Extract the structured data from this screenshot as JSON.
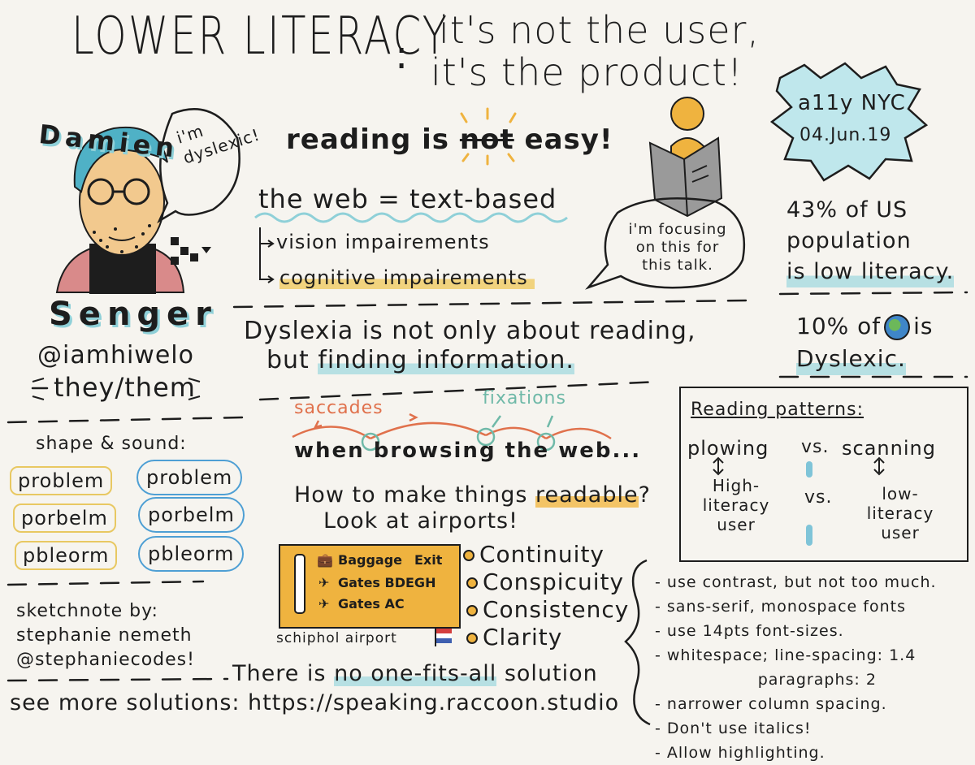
{
  "title": {
    "main": "LOWER LITERACY",
    "colon": ":",
    "line1": "it's not the user,",
    "line2": "it's the product!"
  },
  "speaker": {
    "first": "Damien",
    "last": "Senger",
    "handle": "@iamhiwelo",
    "pronouns": "they/them",
    "bubble": [
      "i'm",
      "dyslexic!"
    ]
  },
  "event": {
    "name": "a11y NYC",
    "date": "04.Jun.19"
  },
  "reading": {
    "pre": "reading is ",
    "not": "not",
    "post": " easy!"
  },
  "web": {
    "line": "the web = text-based",
    "items": [
      "vision impairements",
      "cognitive impairements"
    ],
    "bubble": "i'm focusing on this for this talk."
  },
  "stats": {
    "literacy": [
      "43% of US",
      "population",
      "is low literacy."
    ],
    "dyslexic_pre": "10% of",
    "dyslexic_post": "is",
    "dyslexic_line2": "Dyslexic."
  },
  "dyslexia": {
    "line1": "Dyslexia is not only about reading,",
    "line2_pre": "but ",
    "line2_hl": "finding information."
  },
  "eye": {
    "saccades": "saccades",
    "fixations": "fixations",
    "sentence": "when browsing the web..."
  },
  "readable": {
    "q_pre": "How to make things ",
    "q_hl": "readable",
    "q_post": "?",
    "airports": "Look at airports!"
  },
  "sign": {
    "baggage": "Baggage",
    "exit": "Exit",
    "gates1": "Gates BDEGH",
    "gates2": "Gates AC",
    "caption": "schiphol airport"
  },
  "principles": [
    "Continuity",
    "Conspicuity",
    "Consistency",
    "Clarity"
  ],
  "patterns": {
    "title": "Reading patterns:",
    "left": "plowing",
    "vs": "vs.",
    "right": "scanning",
    "left_user": "High-literacy user",
    "right_user": "low-literacy user"
  },
  "shape": {
    "title": "shape & sound:",
    "words": [
      "problem",
      "porbelm",
      "pbleorm"
    ]
  },
  "credit": [
    "sketchnote by:",
    "stephanie nemeth",
    "@stephaniecodes!"
  ],
  "footer": {
    "nofit_pre": "There is ",
    "nofit_hl": "no one-fits-all",
    "nofit_post": " solution",
    "more": "see more solutions: https://speaking.raccoon.studio"
  },
  "tips": [
    "- use contrast, but not too much.",
    "- sans-serif, monospace fonts",
    "- use 14pts font-sizes.",
    "- whitespace; line-spacing: 1.4",
    "                  paragraphs: 2",
    "- narrower column spacing.",
    "- Don't use italics!",
    "- Allow highlighting."
  ],
  "colors": {
    "yellow": "#efb33f",
    "teal": "#b7e0e3",
    "orange": "#e0714c",
    "blue": "#4e9fd4"
  }
}
